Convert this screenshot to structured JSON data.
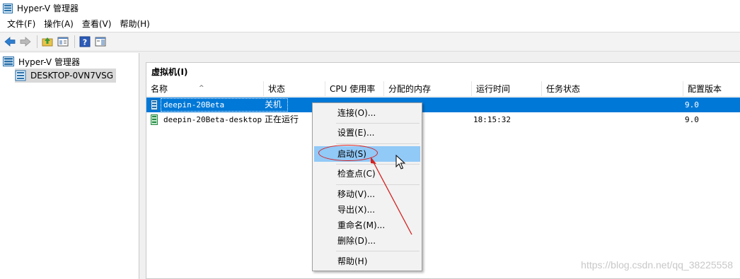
{
  "window": {
    "title": "Hyper-V 管理器"
  },
  "menubar": [
    "文件(F)",
    "操作(A)",
    "查看(V)",
    "帮助(H)"
  ],
  "toolbar": [
    "back-arrow-icon",
    "forward-arrow-icon",
    "up-folder-icon",
    "show-hide-tree-icon",
    "help-icon",
    "action-pane-icon"
  ],
  "tree": {
    "root": "Hyper-V 管理器",
    "server": "DESKTOP-0VN7VSG"
  },
  "vm_panel": {
    "title": "虚拟机(I)",
    "columns": [
      "名称",
      "状态",
      "CPU 使用率",
      "分配的内存",
      "运行时间",
      "任务状态",
      "配置版本"
    ],
    "rows": [
      {
        "name": "deepin-20Beta",
        "state": "关机",
        "cpu": "",
        "memory": "",
        "uptime": "",
        "task": "",
        "version": "9.0"
      },
      {
        "name": "deepin-20Beta-desktop",
        "state": "正在运行",
        "cpu": "",
        "memory": "",
        "uptime": "18:15:32",
        "task": "",
        "version": "9.0"
      }
    ]
  },
  "context_menu": {
    "connect": "连接(O)...",
    "settings": "设置(E)...",
    "start": "启动(S)",
    "checkpoint": "检查点(C)",
    "move": "移动(V)...",
    "export": "导出(X)...",
    "rename": "重命名(M)...",
    "delete": "删除(D)...",
    "help": "帮助(H)"
  },
  "colors": {
    "selection": "#0078d7",
    "menu_highlight": "#91c9f7",
    "annotation": "#d42020"
  },
  "watermark": "https://blog.csdn.net/qq_38225558"
}
